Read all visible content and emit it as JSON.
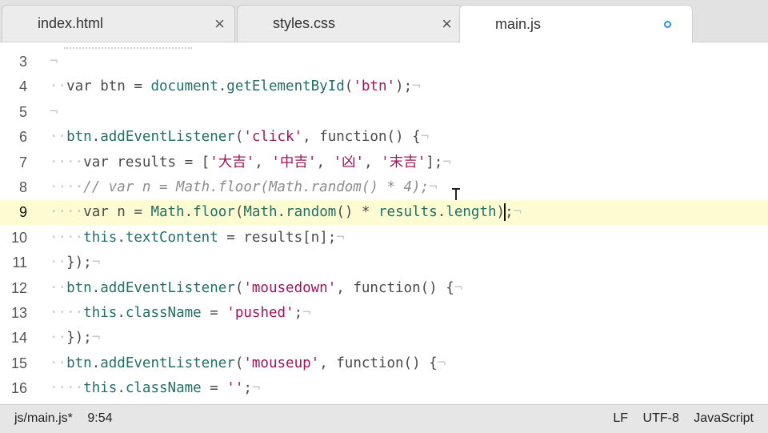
{
  "tabs": [
    {
      "label": "index.html",
      "state": "close"
    },
    {
      "label": "styles.css",
      "state": "close"
    },
    {
      "label": "main.js",
      "state": "modified"
    }
  ],
  "editor": {
    "current_line": 9,
    "lines": [
      {
        "num": "3",
        "tokens": [
          {
            "t": "ws",
            "v": "¬"
          }
        ]
      },
      {
        "num": "4",
        "tokens": [
          {
            "t": "ws",
            "v": "··"
          },
          {
            "t": "kw",
            "v": "var btn = "
          },
          {
            "t": "ob",
            "v": "document"
          },
          {
            "t": "kw",
            "v": "."
          },
          {
            "t": "ob",
            "v": "getElementById"
          },
          {
            "t": "kw",
            "v": "("
          },
          {
            "t": "str",
            "v": "'btn'"
          },
          {
            "t": "kw",
            "v": ");"
          },
          {
            "t": "eol",
            "v": "¬"
          }
        ]
      },
      {
        "num": "5",
        "tokens": [
          {
            "t": "ws",
            "v": "¬"
          }
        ]
      },
      {
        "num": "6",
        "tokens": [
          {
            "t": "ws",
            "v": "··"
          },
          {
            "t": "ob",
            "v": "btn"
          },
          {
            "t": "kw",
            "v": "."
          },
          {
            "t": "ob",
            "v": "addEventListener"
          },
          {
            "t": "kw",
            "v": "("
          },
          {
            "t": "str",
            "v": "'click'"
          },
          {
            "t": "kw",
            "v": ", function() {"
          },
          {
            "t": "eol",
            "v": "¬"
          }
        ]
      },
      {
        "num": "7",
        "tokens": [
          {
            "t": "ws",
            "v": "····"
          },
          {
            "t": "kw",
            "v": "var results = ["
          },
          {
            "t": "str",
            "v": "'大吉'"
          },
          {
            "t": "kw",
            "v": ", "
          },
          {
            "t": "str",
            "v": "'中吉'"
          },
          {
            "t": "kw",
            "v": ", "
          },
          {
            "t": "str",
            "v": "'凶'"
          },
          {
            "t": "kw",
            "v": ", "
          },
          {
            "t": "str",
            "v": "'末吉'"
          },
          {
            "t": "kw",
            "v": "];"
          },
          {
            "t": "eol",
            "v": "¬"
          }
        ]
      },
      {
        "num": "8",
        "tokens": [
          {
            "t": "ws",
            "v": "····"
          },
          {
            "t": "cm",
            "v": "// var n = Math.floor(Math.random() * 4);"
          },
          {
            "t": "eol",
            "v": "¬"
          }
        ]
      },
      {
        "num": "9",
        "tokens": [
          {
            "t": "ws",
            "v": "····"
          },
          {
            "t": "kw",
            "v": "var n = "
          },
          {
            "t": "ob",
            "v": "Math"
          },
          {
            "t": "kw",
            "v": "."
          },
          {
            "t": "ob",
            "v": "floor"
          },
          {
            "t": "kw",
            "v": "("
          },
          {
            "t": "ob",
            "v": "Math"
          },
          {
            "t": "kw",
            "v": "."
          },
          {
            "t": "ob",
            "v": "random"
          },
          {
            "t": "kw",
            "v": "() * "
          },
          {
            "t": "ob",
            "v": "results"
          },
          {
            "t": "kw",
            "v": "."
          },
          {
            "t": "ob",
            "v": "length"
          },
          {
            "t": "kw",
            "v": ")"
          },
          {
            "t": "cursor",
            "v": ""
          },
          {
            "t": "kw",
            "v": ";"
          },
          {
            "t": "eol",
            "v": "¬"
          }
        ]
      },
      {
        "num": "10",
        "tokens": [
          {
            "t": "ws",
            "v": "····"
          },
          {
            "t": "ob",
            "v": "this"
          },
          {
            "t": "kw",
            "v": "."
          },
          {
            "t": "ob",
            "v": "textContent"
          },
          {
            "t": "kw",
            "v": " = results[n];"
          },
          {
            "t": "eol",
            "v": "¬"
          }
        ]
      },
      {
        "num": "11",
        "tokens": [
          {
            "t": "ws",
            "v": "··"
          },
          {
            "t": "kw",
            "v": "});"
          },
          {
            "t": "eol",
            "v": "¬"
          }
        ]
      },
      {
        "num": "12",
        "tokens": [
          {
            "t": "ws",
            "v": "··"
          },
          {
            "t": "ob",
            "v": "btn"
          },
          {
            "t": "kw",
            "v": "."
          },
          {
            "t": "ob",
            "v": "addEventListener"
          },
          {
            "t": "kw",
            "v": "("
          },
          {
            "t": "str",
            "v": "'mousedown'"
          },
          {
            "t": "kw",
            "v": ", function() {"
          },
          {
            "t": "eol",
            "v": "¬"
          }
        ]
      },
      {
        "num": "13",
        "tokens": [
          {
            "t": "ws",
            "v": "····"
          },
          {
            "t": "ob",
            "v": "this"
          },
          {
            "t": "kw",
            "v": "."
          },
          {
            "t": "ob",
            "v": "className"
          },
          {
            "t": "kw",
            "v": " = "
          },
          {
            "t": "str",
            "v": "'pushed'"
          },
          {
            "t": "kw",
            "v": ";"
          },
          {
            "t": "eol",
            "v": "¬"
          }
        ]
      },
      {
        "num": "14",
        "tokens": [
          {
            "t": "ws",
            "v": "··"
          },
          {
            "t": "kw",
            "v": "});"
          },
          {
            "t": "eol",
            "v": "¬"
          }
        ]
      },
      {
        "num": "15",
        "tokens": [
          {
            "t": "ws",
            "v": "··"
          },
          {
            "t": "ob",
            "v": "btn"
          },
          {
            "t": "kw",
            "v": "."
          },
          {
            "t": "ob",
            "v": "addEventListener"
          },
          {
            "t": "kw",
            "v": "("
          },
          {
            "t": "str",
            "v": "'mouseup'"
          },
          {
            "t": "kw",
            "v": ", function() {"
          },
          {
            "t": "eol",
            "v": "¬"
          }
        ]
      },
      {
        "num": "16",
        "tokens": [
          {
            "t": "ws",
            "v": "····"
          },
          {
            "t": "ob",
            "v": "this"
          },
          {
            "t": "kw",
            "v": "."
          },
          {
            "t": "ob",
            "v": "className"
          },
          {
            "t": "kw",
            "v": " = "
          },
          {
            "t": "str",
            "v": "''"
          },
          {
            "t": "kw",
            "v": ";"
          },
          {
            "t": "eol",
            "v": "¬"
          }
        ]
      }
    ]
  },
  "status": {
    "file_path": "js/main.js*",
    "cursor_position": "9:54",
    "line_ending": "LF",
    "encoding": "UTF-8",
    "language": "JavaScript"
  },
  "colors": {
    "string": "#a0155a",
    "object": "#236e66",
    "comment": "#8d8d8d",
    "current_line_bg": "#fdfbd2",
    "modified_dot": "#2f8fe0"
  }
}
